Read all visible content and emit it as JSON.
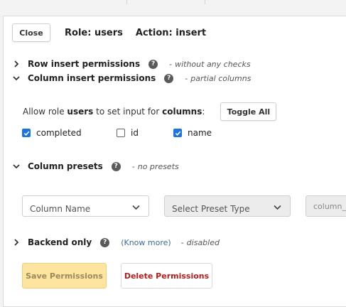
{
  "header": {
    "close_label": "Close",
    "role_title": "Role: users",
    "action_title": "Action: insert"
  },
  "sections": {
    "row_insert": {
      "title": "Row insert permissions",
      "help": "?",
      "dash": "-",
      "note": "without any checks",
      "expanded": false
    },
    "column_insert": {
      "title": "Column insert permissions",
      "help": "?",
      "dash": "-",
      "note": "partial columns",
      "expanded": true
    },
    "column_presets": {
      "title": "Column presets",
      "help": "?",
      "dash": "-",
      "note": "no presets",
      "expanded": true
    },
    "backend_only": {
      "title": "Backend only",
      "help": "?",
      "know_more": "(Know more)",
      "dash": "-",
      "note": "disabled",
      "expanded": false
    }
  },
  "allow": {
    "prefix": "Allow role ",
    "role": "users",
    "middle": " to set input for ",
    "columns_word": "columns",
    "suffix": ":",
    "toggle_all_label": "Toggle All"
  },
  "columns": [
    {
      "name": "completed",
      "checked": true
    },
    {
      "name": "id",
      "checked": false
    },
    {
      "name": "name",
      "checked": true
    }
  ],
  "presets": {
    "column_name_placeholder": "Column Name",
    "preset_type_placeholder": "Select Preset Type",
    "value_placeholder": "column_v"
  },
  "footer": {
    "save_label": "Save Permissions",
    "delete_label": "Delete Permissions"
  },
  "colors": {
    "checkbox_checked": "#1a73e8",
    "save_button_bg": "#fde5a0",
    "delete_text": "#b71c1c",
    "link": "#3b6aa0"
  }
}
